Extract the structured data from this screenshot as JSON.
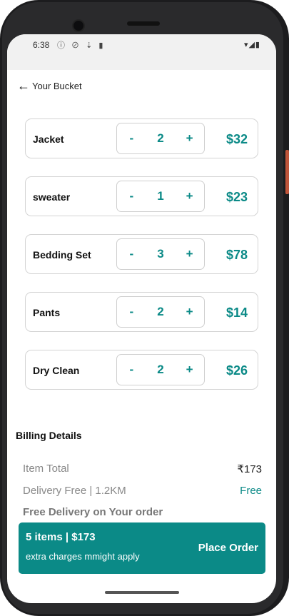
{
  "status_bar": {
    "time": "6:38",
    "left_icons": "ⓘ ⊘ ⇣ ▮",
    "right_icons": "▾◢▮"
  },
  "header": {
    "back_icon": "←",
    "title": "Your Bucket"
  },
  "cart": {
    "items": [
      {
        "name": "Jacket",
        "minus": "-",
        "qty": "2",
        "plus": "+",
        "price": "$32"
      },
      {
        "name": "sweater",
        "minus": "-",
        "qty": "1",
        "plus": "+",
        "price": "$23"
      },
      {
        "name": "Bedding Set",
        "minus": "-",
        "qty": "3",
        "plus": "+",
        "price": "$78"
      },
      {
        "name": "Pants",
        "minus": "-",
        "qty": "2",
        "plus": "+",
        "price": "$14"
      },
      {
        "name": "Dry Clean",
        "minus": "-",
        "qty": "2",
        "plus": "+",
        "price": "$26"
      }
    ]
  },
  "billing": {
    "title": "Billing Details",
    "item_total_label": "Item Total",
    "item_total_value": "₹173",
    "delivery_label": "Delivery Free | 1.2KM",
    "delivery_value": "Free",
    "free_delivery_note": "Free Delivery on Your order"
  },
  "order_bar": {
    "summary": "5 items | $173",
    "note": "extra charges mmight apply",
    "place_order": "Place Order"
  },
  "colors": {
    "accent": "#0b8a87"
  }
}
